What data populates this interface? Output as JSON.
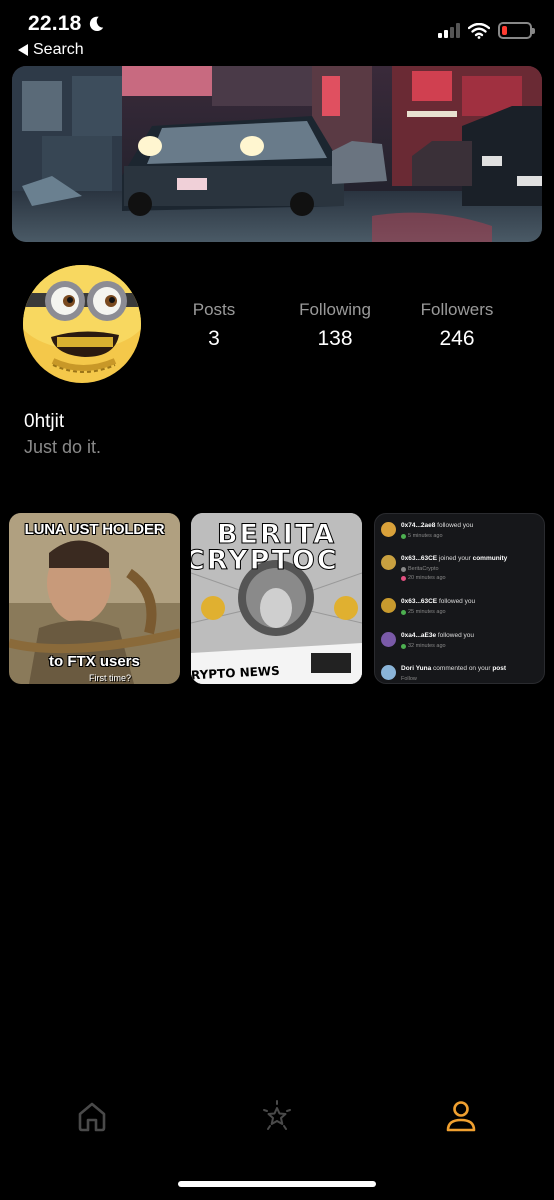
{
  "status_bar": {
    "time": "22.18",
    "back_label": "Search",
    "signal_bars": 2,
    "battery_level": 0.2,
    "battery_color": "#ff3b30",
    "icons": [
      "moon-icon",
      "signal-icon",
      "wifi-icon",
      "battery-icon"
    ]
  },
  "banner": {
    "description_icon": "city-street-car-banner"
  },
  "profile": {
    "avatar_icon": "minion-avatar",
    "stats": [
      {
        "label": "Posts",
        "value": "3"
      },
      {
        "label": "Following",
        "value": "138"
      },
      {
        "label": "Followers",
        "value": "246"
      }
    ],
    "username": "0htjit",
    "bio": "Just do it."
  },
  "posts": [
    {
      "top_text": "LUNA UST HOLDER",
      "bottom_text": "to FTX users",
      "sub_text": "First time?"
    },
    {
      "title_line1": "BERITA",
      "title_line2": "CRYPTOC",
      "news_text": "RYPTO NEWS"
    },
    {
      "notifications": [
        {
          "actor": "0x74...2ae8",
          "action": "followed you",
          "target": "",
          "meta": "5 minutes ago",
          "color": "#d9a13a"
        },
        {
          "actor": "0x63...63CE",
          "action": "joined your",
          "target": "community",
          "meta": "BeritaCrypto",
          "meta2": "20 minutes ago",
          "color": "#c8a040"
        },
        {
          "actor": "0x63...63CE",
          "action": "followed you",
          "target": "",
          "meta": "25 minutes ago",
          "color": "#c89a2e"
        },
        {
          "actor": "0xa4...aE3e",
          "action": "followed you",
          "target": "",
          "meta": "32 minutes ago",
          "color": "#7a5aa8"
        },
        {
          "actor": "Dori Yuna",
          "action": "commented on your",
          "target": "post",
          "meta": "Follow",
          "color": "#8ab4d8"
        }
      ]
    }
  ],
  "nav": {
    "items": [
      {
        "name": "home",
        "icon": "home-icon",
        "active": false
      },
      {
        "name": "discover",
        "icon": "star-icon",
        "active": false
      },
      {
        "name": "profile",
        "icon": "person-icon",
        "active": true
      }
    ],
    "active_color": "#f0a030",
    "inactive_color": "#4a4a4a"
  }
}
